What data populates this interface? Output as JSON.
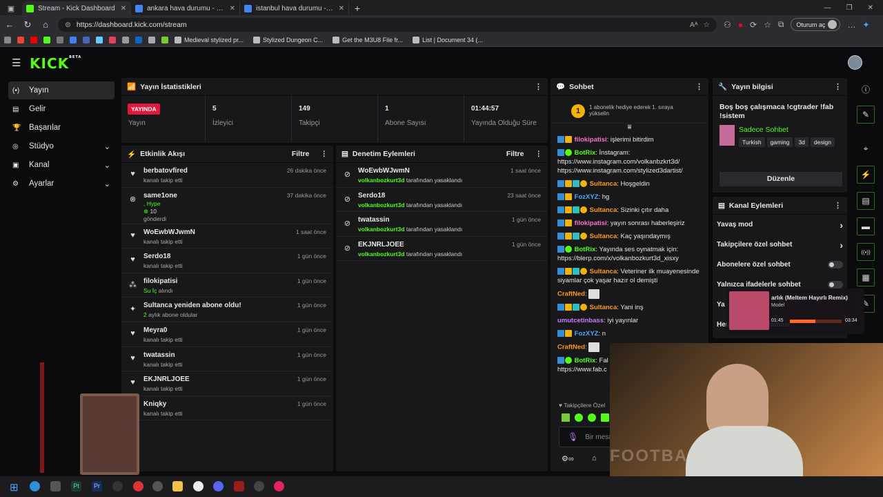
{
  "browser": {
    "tabs": [
      {
        "title": "Stream - Kick Dashboard",
        "color": "#53fc18",
        "active": true
      },
      {
        "title": "ankara hava durumu - Google'da",
        "color": "#4285f4"
      },
      {
        "title": "istanbul hava durumu - Google'da",
        "color": "#4285f4"
      }
    ],
    "url": "https://dashboard.kick.com/stream",
    "signin": "Oturum aç",
    "bookmarks": [
      "Medieval stylized pr...",
      "Stylized Dungeon C...",
      "Get the M3U8 File fr...",
      "List | Document 34 (..."
    ]
  },
  "app": {
    "logo": "KICK",
    "beta": "BETA"
  },
  "sidebar": [
    {
      "label": "Yayın",
      "icon": "stream-icon",
      "active": true
    },
    {
      "label": "Gelir",
      "icon": "revenue-icon"
    },
    {
      "label": "Başarılar",
      "icon": "trophy-icon"
    },
    {
      "label": "Stüdyo",
      "icon": "studio-icon",
      "chev": true
    },
    {
      "label": "Kanal",
      "icon": "channel-icon",
      "chev": true
    },
    {
      "label": "Ayarlar",
      "icon": "settings-icon",
      "chev": true
    }
  ],
  "stats": {
    "title": "Yayın İstatistikleri",
    "live_badge": "YAYINDA",
    "items": [
      {
        "value": "",
        "label": "Yayın"
      },
      {
        "value": "5",
        "label": "İzleyici"
      },
      {
        "value": "149",
        "label": "Takipçi"
      },
      {
        "value": "1",
        "label": "Abone Sayısı"
      },
      {
        "value": "01:44:57",
        "label": "Yayında Olduğu Süre"
      }
    ]
  },
  "activity": {
    "title": "Etkinlik Akışı",
    "filter": "Filtre",
    "rows": [
      {
        "name": "berbatovfired",
        "sub": "kanalı takip etti",
        "time": "26 dakika önce",
        "icon": "heart"
      },
      {
        "name": "same1one",
        "sub": ", Hype",
        "sub2": "10",
        "sub3": "gönderdi",
        "time": "37 dakika önce",
        "icon": "kick"
      },
      {
        "name": "WoEwbWJwmN",
        "sub": "kanalı takip etti",
        "time": "1 saat önce",
        "icon": "heart"
      },
      {
        "name": "Serdo18",
        "sub": "kanalı takip etti",
        "time": "1 gün önce",
        "icon": "heart"
      },
      {
        "name": "filokipatisi",
        "sub": "Su İç",
        "sub_b": "alındı",
        "time": "1 gün önce",
        "icon": "dots"
      },
      {
        "name": "Sultanca yeniden abone oldu!",
        "sub": "2",
        "sub_b": "aylık abone oldular",
        "time": "1 gün önce",
        "icon": "star"
      },
      {
        "name": "Meyra0",
        "sub": "kanalı takip etti",
        "time": "1 gün önce",
        "icon": "heart"
      },
      {
        "name": "twatassin",
        "sub": "kanalı takip etti",
        "time": "1 gün önce",
        "icon": "heart"
      },
      {
        "name": "EKJNRLJOEE",
        "sub": "kanalı takip etti",
        "time": "1 gün önce",
        "icon": "heart"
      },
      {
        "name": "Kniqky",
        "sub": "kanalı takip etti",
        "time": "1 gün önce",
        "icon": "heart"
      }
    ]
  },
  "moderation": {
    "title": "Denetim Eylemleri",
    "filter": "Filtre",
    "rows": [
      {
        "name": "WoEwbWJwmN",
        "by": "volkanbozkurt3d",
        "action": "tarafından yasaklandı",
        "time": "1 saat önce"
      },
      {
        "name": "Serdo18",
        "by": "volkanbozkurt3d",
        "action": "tarafından yasaklandı",
        "time": "23 saat önce"
      },
      {
        "name": "twatassin",
        "by": "volkanbozkurt3d",
        "action": "tarafından yasaklandı",
        "time": "1 gün önce"
      },
      {
        "name": "EKJNRLJOEE",
        "by": "volkanbozkurt3d",
        "action": "tarafından yasaklandı",
        "time": "1 gün önce"
      }
    ]
  },
  "chat": {
    "title": "Sohbet",
    "promo": "1 abonelik hediye ederek 1. sıraya yükselin",
    "promo_num": "1",
    "messages": [
      {
        "user": "filokipatisi",
        "color": "#ff6fc8",
        "text": "işlerimi bitirdim"
      },
      {
        "user": "BotRix",
        "color": "#53fc18",
        "text": "İnstagram:",
        "links": [
          "https://www.instagram.com/volkanbzkrt3d/",
          "https://www.instagram.com/stylized3dartist/"
        ]
      },
      {
        "user": "Sultanca",
        "color": "#ff9a1f",
        "text": "Hoşgeldin"
      },
      {
        "user": "FozXYZ",
        "color": "#4aa8ff",
        "text": "hg"
      },
      {
        "user": "Sultanca",
        "color": "#ff9a1f",
        "text": "Sizinki çıtır daha"
      },
      {
        "user": "filokipatisi",
        "color": "#ff6fc8",
        "text": "yayın sonrası haberleşiriz"
      },
      {
        "user": "Sultanca",
        "color": "#ff9a1f",
        "text": "Kaç yaşındaymış"
      },
      {
        "user": "BotRix",
        "color": "#53fc18",
        "text": "Yayında ses oynatmak için:",
        "links": [
          "https://blerp.com/x/volkanbozkurt3d_xisxy"
        ]
      },
      {
        "user": "Sultanca",
        "color": "#ff9a1f",
        "text": "Veteriner ilk muayenesinde siyamlar çok yaşar hazır ol demişti"
      },
      {
        "user": "CraftNed",
        "color": "#ff9a1f",
        "text": ""
      },
      {
        "user": "Sultanca",
        "color": "#ff9a1f",
        "text": "Yani inş"
      },
      {
        "user": "umutcetinbass",
        "color": "#c77dff",
        "text": "iyi yayınlar"
      },
      {
        "user": "FozXYZ",
        "color": "#4aa8ff",
        "text": "n"
      },
      {
        "user": "CraftNed",
        "color": "#ff9a1f",
        "text": ""
      },
      {
        "user": "BotRix",
        "color": "#53fc18",
        "text": "Fal",
        "links": [
          "https://www.fab.c"
        ]
      }
    ],
    "followers_only": "Takipçilere Özel",
    "placeholder": "Bir mesa"
  },
  "info": {
    "title": "Yayın bilgisi",
    "stream_title": "Boş boş çalışmaca !cgtrader !fab !sistem",
    "category": "Sadece Sohbet",
    "tags": [
      "Turkish",
      "gaming",
      "3d",
      "design"
    ],
    "edit": "Düzenle"
  },
  "channel_actions": {
    "title": "Kanal Eylemleri",
    "items": [
      "Yavaş mod",
      "Takipçilere özel sohbet",
      "Abonelere özel sohbet",
      "Yalnızca ifadelerle sohbet",
      "Ya",
      "Hesap yaşı kısıtlaması"
    ]
  },
  "music": {
    "title": "arlık (Meltem Hayırlı Remix)",
    "artist": "Model",
    "elapsed": "01:45",
    "total": "03:34",
    "progress": 0.49
  },
  "webcam": {
    "text": "FOOTBALL"
  }
}
